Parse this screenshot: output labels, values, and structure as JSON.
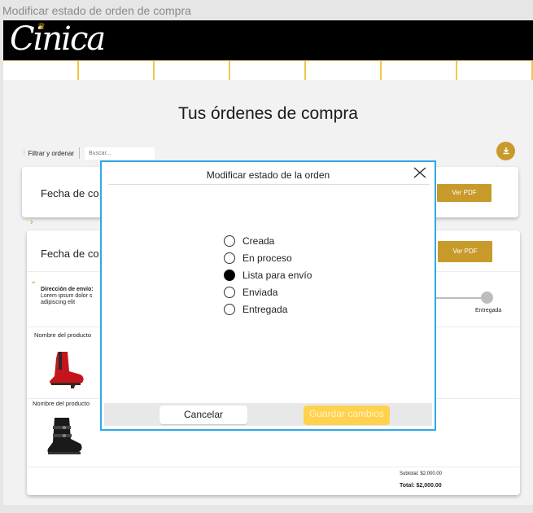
{
  "frame": {
    "title": "Modificar estado de orden de compra"
  },
  "brand": {
    "logo_text": "Cinica",
    "accent_color": "#c79a2a",
    "modal_border_color": "#2fa8e8"
  },
  "page": {
    "heading": "Tus órdenes de compra"
  },
  "toolbar": {
    "filter_label": "Filtrar y ordenar",
    "search_placeholder": "Buscar...",
    "download_icon": "download-icon"
  },
  "orders": [
    {
      "date_label": "Fecha de co",
      "pdf_label": "Ver PDF"
    },
    {
      "date_label": "Fecha de co",
      "pdf_label": "Ver PDF"
    }
  ],
  "details": {
    "shipping_title": "Dirección de envío:",
    "shipping_text": "Lorem ipsum dolor s adipiscing elit",
    "tracking_label": "Entregada",
    "products": [
      {
        "name": "Nombre del producto",
        "image": "red-boot"
      },
      {
        "name": "Nombre del producto",
        "image": "black-boot"
      }
    ],
    "subtotal": "Subtotal: $2,000.00",
    "total": "Total: $2,000.00"
  },
  "modal": {
    "title": "Modificar estado de la orden",
    "options": [
      {
        "label": "Creada",
        "selected": false
      },
      {
        "label": "En proceso",
        "selected": false
      },
      {
        "label": "Lista para envío",
        "selected": true
      },
      {
        "label": "Enviada",
        "selected": false
      },
      {
        "label": "Entregada",
        "selected": false
      }
    ],
    "cancel_label": "Cancelar",
    "save_label": "Guardar cambios"
  }
}
